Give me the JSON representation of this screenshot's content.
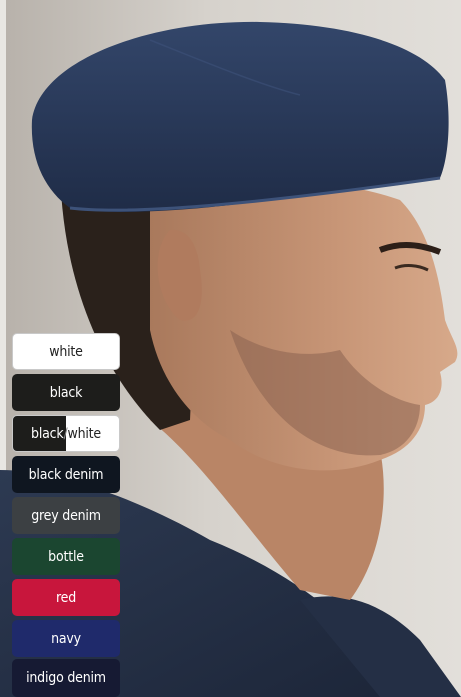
{
  "product": {
    "image_alt": "model wearing indigo denim chef skull cap, side profile",
    "fabric_color": "#2c3a55"
  },
  "swatches": [
    {
      "label": "white",
      "color": "#ffffff",
      "text_color": "#222222"
    },
    {
      "label": "black",
      "color": "#1d1d1b",
      "text_color": "#ffffff"
    },
    {
      "label_a": "black",
      "label_sep": "/",
      "label_b": "white",
      "color_a": "#1d1d1b",
      "color_b": "#ffffff"
    },
    {
      "label": "black denim",
      "color": "#0f1620",
      "text_color": "#ffffff"
    },
    {
      "label": "grey denim",
      "color": "#3c4043",
      "text_color": "#ffffff"
    },
    {
      "label": "bottle",
      "color": "#1b4630",
      "text_color": "#ffffff"
    },
    {
      "label": "red",
      "color": "#c8163c",
      "text_color": "#ffffff"
    },
    {
      "label": "navy",
      "color": "#1f2a6b",
      "text_color": "#ffffff"
    },
    {
      "label": "indigo denim",
      "color": "#161a33",
      "text_color": "#ffffff"
    }
  ]
}
